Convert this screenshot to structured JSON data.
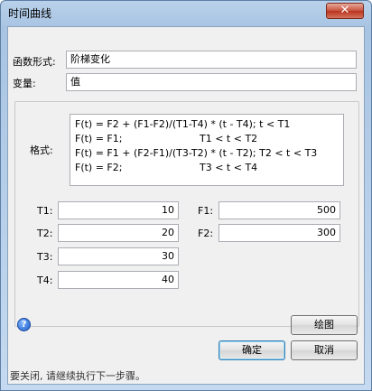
{
  "window": {
    "title": "时间曲线",
    "close_glyph": "✕"
  },
  "func_form": {
    "label": "函数形式:",
    "value": "阶梯变化"
  },
  "variable": {
    "label": "变量:",
    "value": "值"
  },
  "format": {
    "label": "格式:",
    "lines": [
      {
        "a": "F(t) = F2 + (F1-F2)/(T1-T4) * (t - T4); t < T1",
        "b": ""
      },
      {
        "a": "F(t) = F1;",
        "b": "T1 < t < T2"
      },
      {
        "a": "F(t) = F1 + (F2-F1)/(T3-T2) * (t - T2); T2 < t < T3",
        "b": ""
      },
      {
        "a": "F(t) = F2;",
        "b": "T3 < t < T4"
      }
    ]
  },
  "params": {
    "t1": {
      "label": "T1:",
      "value": "10"
    },
    "t2": {
      "label": "T2:",
      "value": "20"
    },
    "t3": {
      "label": "T3:",
      "value": "30"
    },
    "t4": {
      "label": "T4:",
      "value": "40"
    },
    "f1": {
      "label": "F1:",
      "value": "500"
    },
    "f2": {
      "label": "F2:",
      "value": "300"
    }
  },
  "buttons": {
    "plot": "绘图",
    "ok": "确定",
    "cancel": "取消"
  },
  "help": {
    "glyph": "?"
  },
  "status": "要关闭, 请继续执行下一步骤。"
}
